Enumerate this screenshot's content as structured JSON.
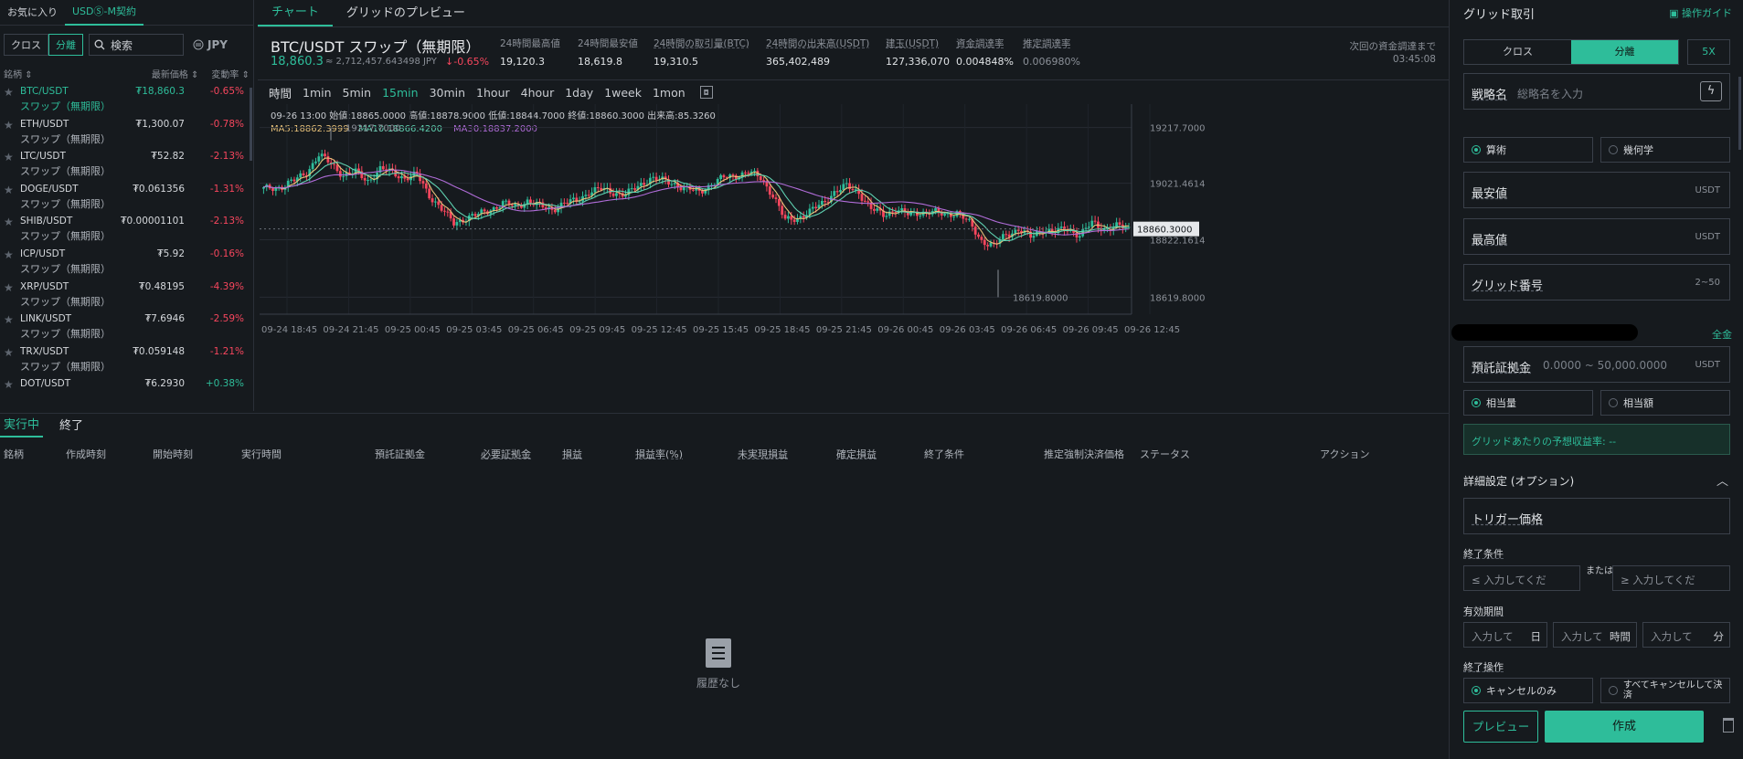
{
  "left": {
    "tabs": [
      "お気に入り",
      "USDⓈ-M契約"
    ],
    "filters": [
      "クロス",
      "分離"
    ],
    "search_placeholder": "検索",
    "currency": "JPY",
    "headers": [
      "銘柄",
      "最新価格",
      "変動率"
    ],
    "markets": [
      {
        "symbol": "BTC/USDT",
        "sub": "スワップ（無期限）",
        "price": "₮18,860.3",
        "change": "-0.65%"
      },
      {
        "symbol": "ETH/USDT",
        "sub": "スワップ（無期限）",
        "price": "₮1,300.07",
        "change": "-0.78%"
      },
      {
        "symbol": "LTC/USDT",
        "sub": "スワップ（無期限）",
        "price": "₮52.82",
        "change": "-2.13%"
      },
      {
        "symbol": "DOGE/USDT",
        "sub": "スワップ（無期限）",
        "price": "₮0.061356",
        "change": "-1.31%"
      },
      {
        "symbol": "SHIB/USDT",
        "sub": "スワップ（無期限）",
        "price": "₮0.00001101",
        "change": "-2.13%"
      },
      {
        "symbol": "ICP/USDT",
        "sub": "スワップ（無期限）",
        "price": "₮5.92",
        "change": "-0.16%"
      },
      {
        "symbol": "XRP/USDT",
        "sub": "スワップ（無期限）",
        "price": "₮0.48195",
        "change": "-4.39%"
      },
      {
        "symbol": "LINK/USDT",
        "sub": "スワップ（無期限）",
        "price": "₮7.6946",
        "change": "-2.59%"
      },
      {
        "symbol": "TRX/USDT",
        "sub": "スワップ（無期限）",
        "price": "₮0.059148",
        "change": "-1.21%"
      },
      {
        "symbol": "DOT/USDT",
        "sub": "",
        "price": "₮6.2930",
        "change": "+0.38%"
      }
    ]
  },
  "center": {
    "tabs": [
      "チャート",
      "グリッドのプレビュー"
    ],
    "ticker": {
      "name": "BTC/USDT スワップ（無期限）",
      "last": "18,860.3",
      "jpy": "≈ 2,712,457.643498 JPY",
      "change": "-0.65%"
    },
    "stats": [
      {
        "label": "24時間最高値",
        "value": "19,120.3"
      },
      {
        "label": "24時間最安値",
        "value": "18,619.8"
      },
      {
        "label": "24時間の取引量(BTC)",
        "value": "19,310.5"
      },
      {
        "label": "24時間の出来高(USDT)",
        "value": "365,402,489"
      },
      {
        "label": "建玉(USDT)",
        "value": "127,336,070"
      },
      {
        "label": "資金調達率",
        "value": "0.004848%"
      },
      {
        "label": "推定調達率",
        "value": "0.006980%"
      }
    ],
    "next_funding_label": "次回の資金調達まで",
    "next_funding_time": "03:45:08",
    "timeframes": [
      "時間",
      "1min",
      "5min",
      "15min",
      "30min",
      "1hour",
      "4hour",
      "1day",
      "1week",
      "1mon"
    ],
    "ohlc_line": "09-26 13:00  始値:18865.0000  高値:18878.9000  低値:18844.7000  終値:18860.3000  出来高:85.3260",
    "ma5": "MA5:18862.3999",
    "ma10": "MA10:18866.4200",
    "ma30": "MA30:18837.2000"
  },
  "chart_data": {
    "type": "candlestick",
    "x_ticks": [
      "09-24 18:45",
      "09-24 21:45",
      "09-25 00:45",
      "09-25 03:45",
      "09-25 06:45",
      "09-25 09:45",
      "09-25 12:45",
      "09-25 15:45",
      "09-25 18:45",
      "09-25 21:45",
      "09-26 00:45",
      "09-26 03:45",
      "09-26 06:45",
      "09-26 09:45",
      "09-26 12:45"
    ],
    "y_ticks": [
      "19217.7000",
      "19021.4614",
      "18822.1614",
      "18619.8000"
    ],
    "ylim": [
      18560,
      19300
    ],
    "current_price_label": "18860.3000",
    "high_marker": "19217.7000",
    "low_marker": "18619.8000",
    "colors": {
      "up": "#2ebd9a",
      "down": "#f6465d",
      "ma5": "#e8c27a",
      "ma10": "#5fd0b0",
      "ma30": "#b06cd8"
    },
    "anchors": [
      [
        0,
        19000
      ],
      [
        6,
        19010
      ],
      [
        10,
        19030
      ],
      [
        14,
        19060
      ],
      [
        18,
        19120
      ],
      [
        22,
        19090
      ],
      [
        26,
        19050
      ],
      [
        30,
        19060
      ],
      [
        34,
        19030
      ],
      [
        38,
        19070
      ],
      [
        42,
        19060
      ],
      [
        46,
        19040
      ],
      [
        50,
        19050
      ],
      [
        54,
        18980
      ],
      [
        58,
        18930
      ],
      [
        62,
        18880
      ],
      [
        66,
        18900
      ],
      [
        70,
        18910
      ],
      [
        74,
        18930
      ],
      [
        78,
        18950
      ],
      [
        82,
        18940
      ],
      [
        86,
        18960
      ],
      [
        90,
        18940
      ],
      [
        94,
        18930
      ],
      [
        98,
        18950
      ],
      [
        102,
        18960
      ],
      [
        106,
        18990
      ],
      [
        110,
        19000
      ],
      [
        114,
        18990
      ],
      [
        118,
        18980
      ],
      [
        122,
        19010
      ],
      [
        126,
        19040
      ],
      [
        130,
        19030
      ],
      [
        134,
        19020
      ],
      [
        138,
        19000
      ],
      [
        142,
        18990
      ],
      [
        146,
        19020
      ],
      [
        150,
        19040
      ],
      [
        154,
        19050
      ],
      [
        158,
        19060
      ],
      [
        162,
        19040
      ],
      [
        166,
        18980
      ],
      [
        170,
        18890
      ],
      [
        174,
        18900
      ],
      [
        178,
        18920
      ],
      [
        182,
        18950
      ],
      [
        186,
        18990
      ],
      [
        190,
        19010
      ],
      [
        194,
        18990
      ],
      [
        198,
        18930
      ],
      [
        202,
        18910
      ],
      [
        206,
        18930
      ],
      [
        210,
        18910
      ],
      [
        214,
        18920
      ],
      [
        218,
        18920
      ],
      [
        222,
        18910
      ],
      [
        226,
        18920
      ],
      [
        230,
        18880
      ],
      [
        234,
        18820
      ],
      [
        238,
        18800
      ],
      [
        242,
        18840
      ],
      [
        246,
        18860
      ],
      [
        250,
        18830
      ],
      [
        254,
        18860
      ],
      [
        258,
        18850
      ],
      [
        262,
        18860
      ],
      [
        266,
        18840
      ],
      [
        270,
        18880
      ],
      [
        274,
        18860
      ],
      [
        278,
        18870
      ],
      [
        282,
        18860
      ]
    ]
  },
  "bottom": {
    "tabs": [
      "実行中",
      "終了"
    ],
    "headers": [
      "銘柄",
      "作成時刻",
      "開始時刻",
      "実行時間",
      "預託証拠金",
      "必要証拠金",
      "損益",
      "損益率(%)",
      "未実現損益",
      "確定損益",
      "終了条件",
      "推定強制決済価格",
      "ステータス",
      "アクション"
    ],
    "empty_text": "履歴なし"
  },
  "right": {
    "title": "グリッド取引",
    "guide": "操作ガイド",
    "mode_tabs": [
      "クロス",
      "分離"
    ],
    "leverage": "5X",
    "strategy_label": "戦略名",
    "strategy_placeholder": "総略名を入力",
    "grid_types": [
      "算術",
      "幾何学"
    ],
    "min_price_label": "最安値",
    "max_price_label": "最高値",
    "unit": "USDT",
    "grid_count_label": "グリッド番号",
    "grid_count_range": "2~50",
    "all_label": "全金",
    "margin_label": "預託証拠金",
    "margin_range": "0.0000 ~ 50,000.0000",
    "amount_types": [
      "相当量",
      "相当額"
    ],
    "profit_text": "グリッドあたりの予想収益率: --",
    "advanced_label": "詳細設定 (オプション)",
    "trigger_label": "トリガー価格",
    "end_condition_label": "終了条件",
    "end_low_placeholder": "≤ 入力してくだ",
    "or_label": "または",
    "end_high_placeholder": "≥ 入力してくだ",
    "validity_label": "有効期間",
    "validity_fields": [
      {
        "placeholder": "入力して",
        "unit": "日"
      },
      {
        "placeholder": "入力して",
        "unit": "時間"
      },
      {
        "placeholder": "入力して",
        "unit": "分"
      }
    ],
    "end_action_label": "終了操作",
    "end_actions": [
      "キャンセルのみ",
      "すべてキャンセルして決済"
    ],
    "preview_button": "プレビュー",
    "create_button": "作成"
  }
}
